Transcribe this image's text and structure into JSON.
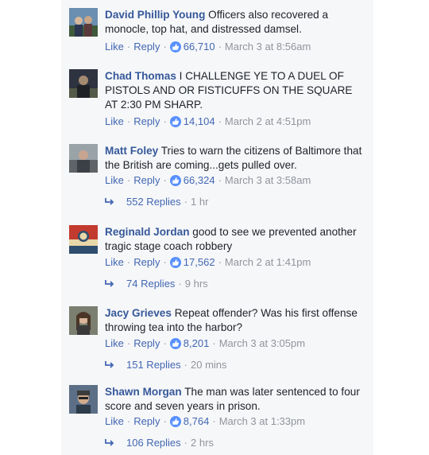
{
  "ui": {
    "like_label": "Like",
    "reply_label": "Reply",
    "separator": "·"
  },
  "comments": [
    {
      "name": "David Phillip Young",
      "text": "Officers also recovered a monocle, top hat, and distressed damsel.",
      "likes": "66,710",
      "time": "March 3 at 8:56am",
      "avatar_icon": "profile-photo-icon"
    },
    {
      "name": "Chad Thomas",
      "text": "I CHALLENGE YE TO A DUEL OF PISTOLS AND OR FISTICUFFS ON THE SQUARE AT 2:30 PM SHARP.",
      "likes": "14,104",
      "time": "March 2 at 4:51pm",
      "avatar_icon": "profile-photo-icon"
    },
    {
      "name": "Matt Foley",
      "text": "Tries to warn the citizens of Baltimore that the British are coming...gets pulled over.",
      "likes": "66,324",
      "time": "March 3 at 3:58am",
      "avatar_icon": "profile-photo-icon",
      "replies_label": "552 Replies",
      "replies_time": "1 hr"
    },
    {
      "name": "Reginald Jordan",
      "text": "good to see we prevented another tragic stage coach robbery",
      "likes": "17,562",
      "time": "March 2 at 1:41pm",
      "avatar_icon": "profile-photo-icon",
      "replies_label": "74 Replies",
      "replies_time": "9 hrs"
    },
    {
      "name": "Jacy Grieves",
      "text": "Repeat offender? Was his first offense throwing tea into the harbor?",
      "likes": "8,201",
      "time": "March 3 at 3:05pm",
      "avatar_icon": "profile-photo-icon",
      "replies_label": "151 Replies",
      "replies_time": "20 mins"
    },
    {
      "name": "Shawn Morgan",
      "text": "The man was later sentenced to four score and seven years in prison.",
      "likes": "8,764",
      "time": "March 3 at 1:33pm",
      "avatar_icon": "profile-photo-icon",
      "replies_label": "106 Replies",
      "replies_time": "2 hrs"
    }
  ],
  "colors": {
    "name": "#365899",
    "link": "#4267b2",
    "meta": "#90949c",
    "text": "#1d2129",
    "like_badge": "#5890ff",
    "panel_bg": "#f6f7f9"
  }
}
